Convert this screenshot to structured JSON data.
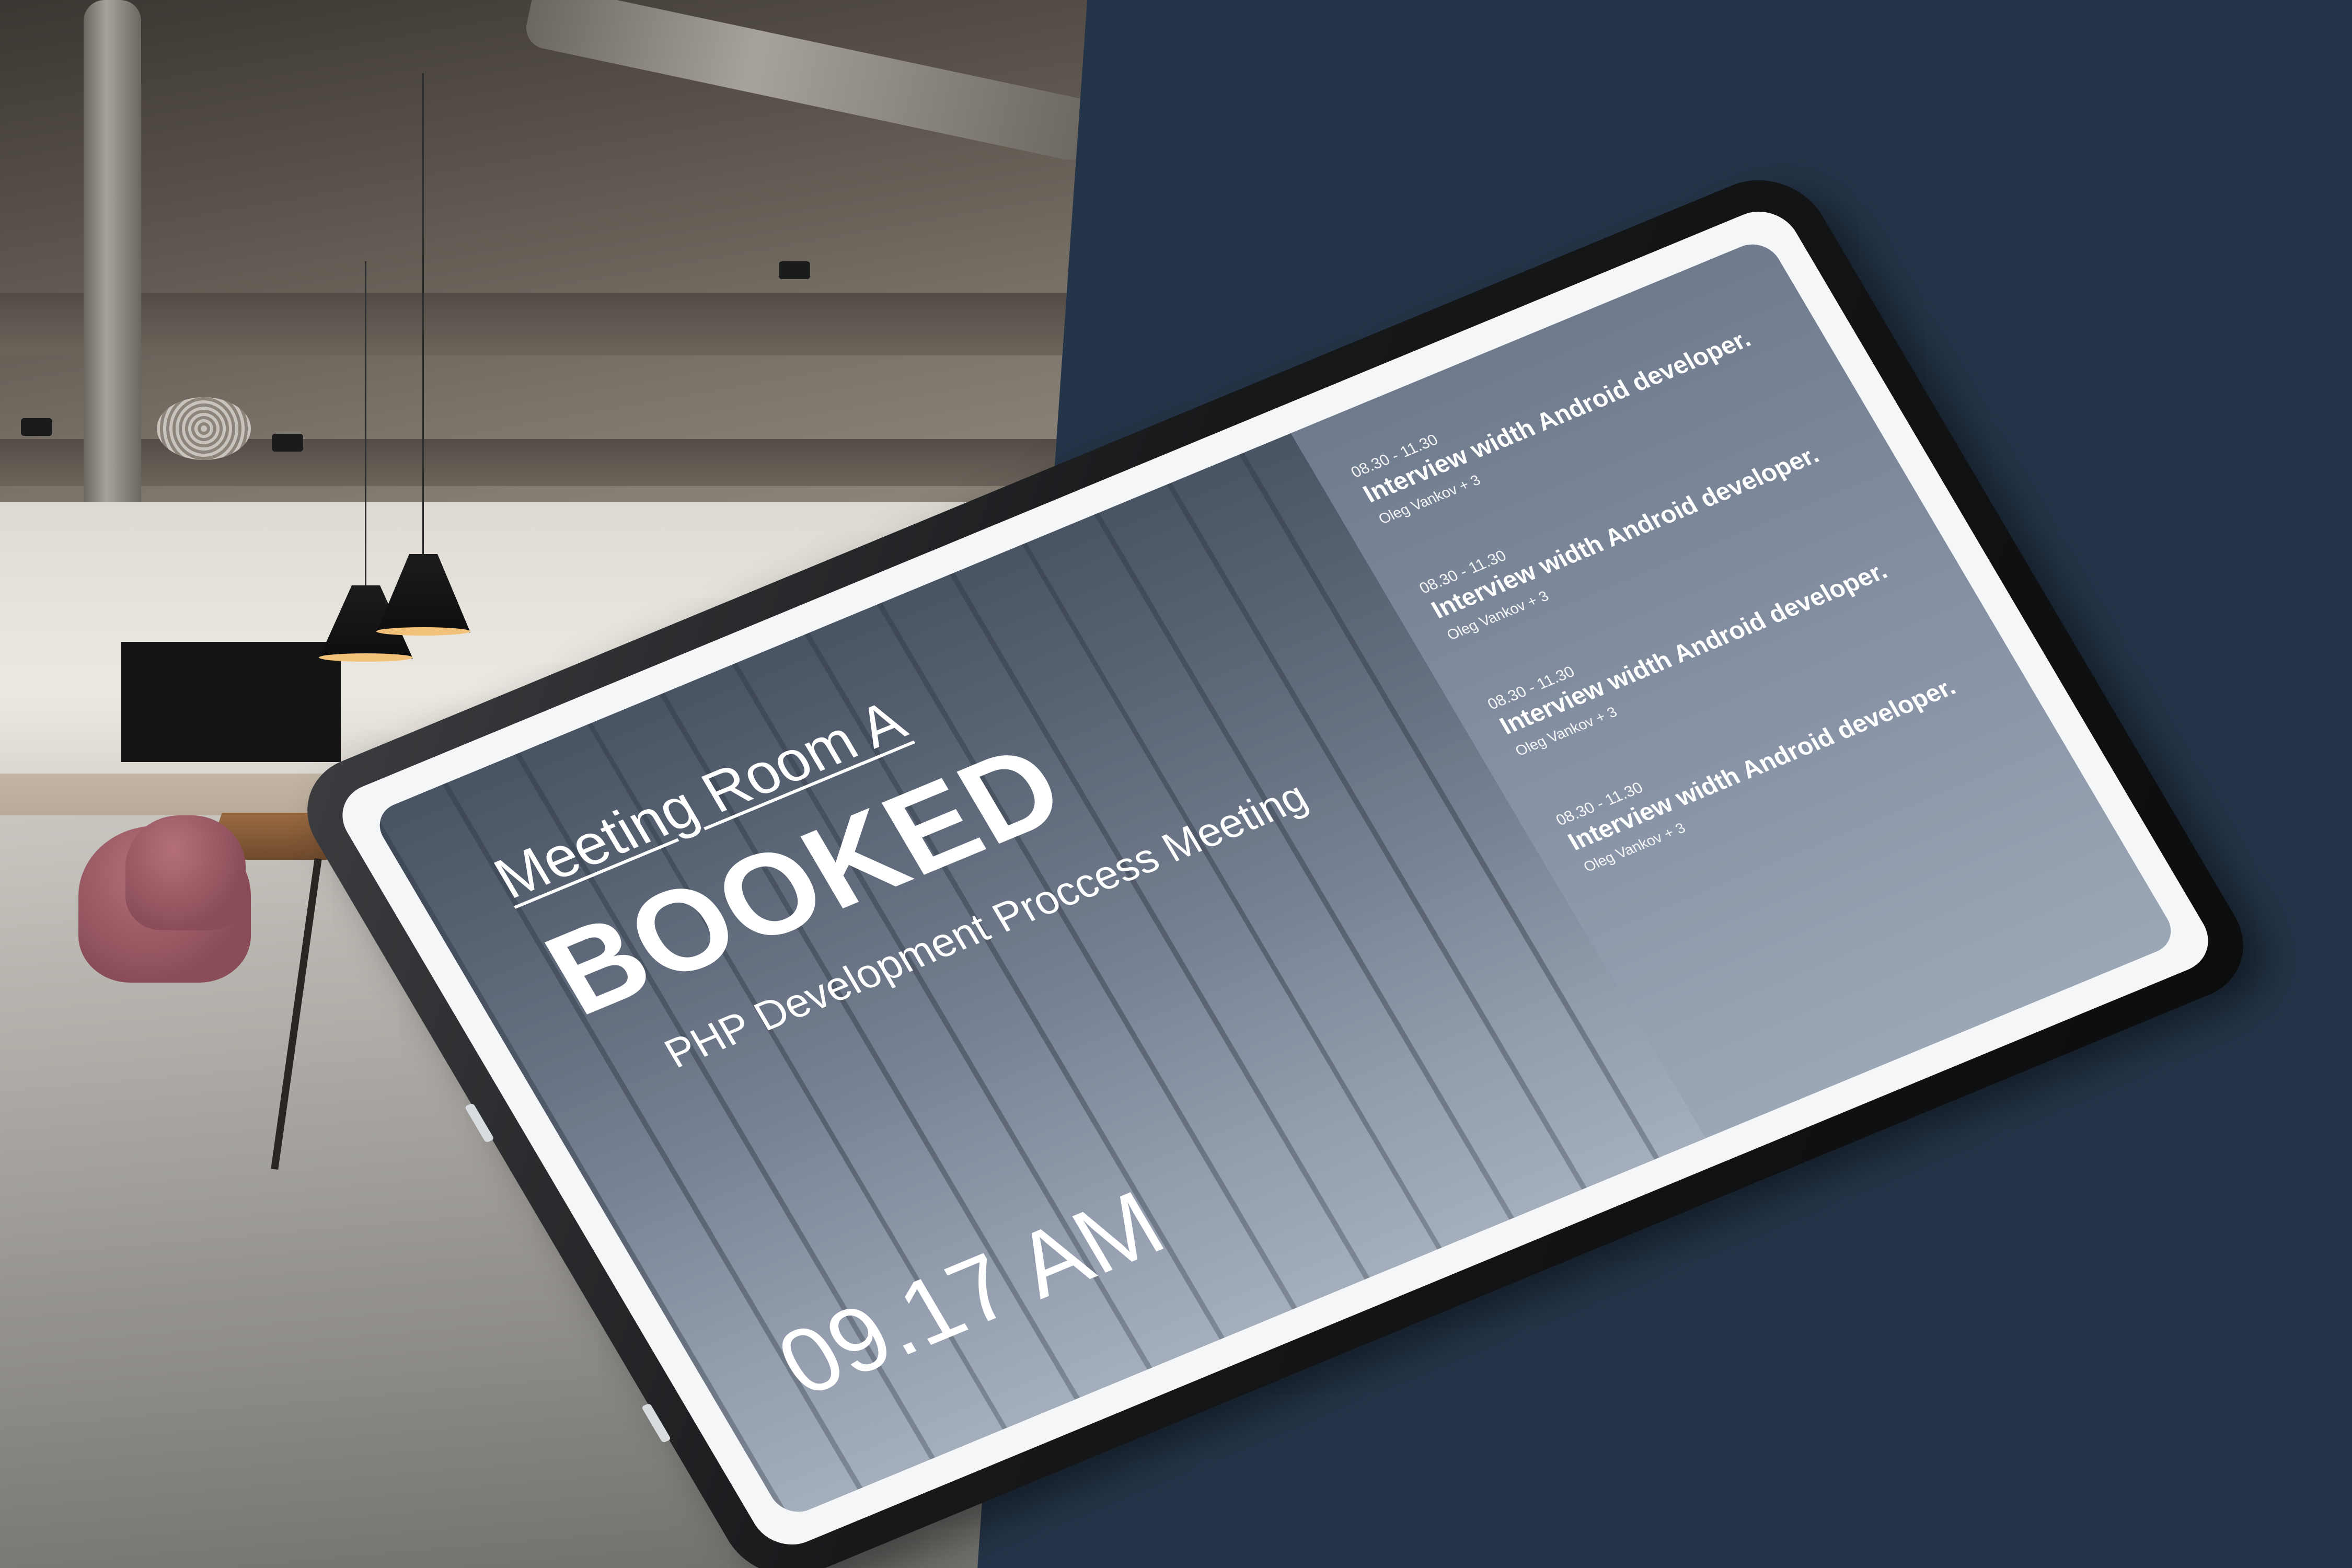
{
  "colors": {
    "background": "#253549",
    "bezel": "#17181a",
    "screen_text": "#ffffff"
  },
  "display": {
    "room_name": "Meeting Room A",
    "status": "BOOKED",
    "current_meeting": "PHP Development Proccess Meeting",
    "clock": "09.17 AM"
  },
  "schedule": [
    {
      "time": "08.30 - 11.30",
      "title": "Interview width Android developer.",
      "attendees": "Oleg Vankov + 3"
    },
    {
      "time": "08.30 - 11.30",
      "title": "Interview width Android developer.",
      "attendees": "Oleg Vankov + 3"
    },
    {
      "time": "08.30 - 11.30",
      "title": "Interview width Android developer.",
      "attendees": "Oleg Vankov + 3"
    },
    {
      "time": "08.30 - 11.30",
      "title": "Interview width Android developer.",
      "attendees": "Oleg Vankov + 3"
    }
  ]
}
